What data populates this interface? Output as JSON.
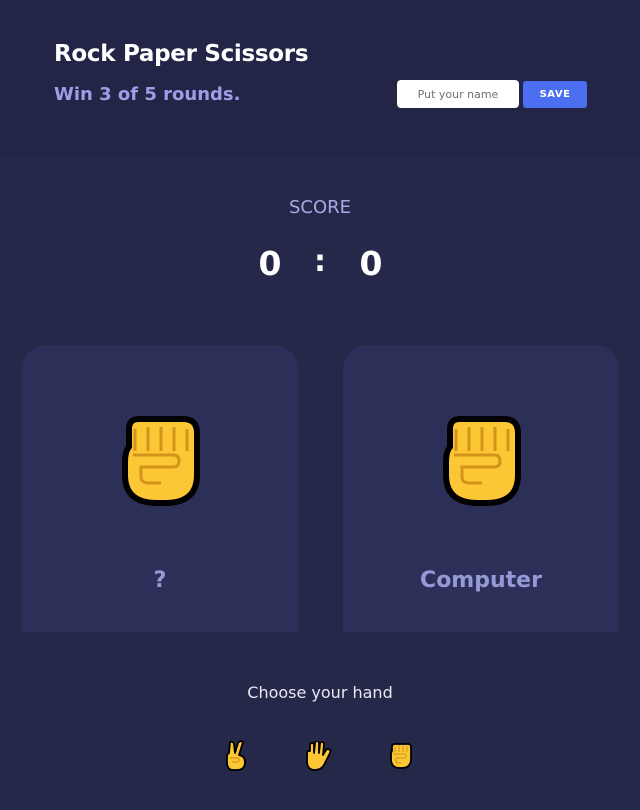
{
  "header": {
    "title": "Rock Paper Scissors",
    "subtitle": "Win 3 of 5 rounds.",
    "name_placeholder": "Put your name",
    "name_value": "",
    "save_label": "SAVE"
  },
  "score": {
    "label": "SCORE",
    "player": "0",
    "separator": ":",
    "computer": "0"
  },
  "cards": {
    "player": {
      "label": "?",
      "hand": "fist-icon"
    },
    "computer": {
      "label": "Computer",
      "hand": "fist-icon"
    }
  },
  "choices": {
    "label": "Choose your hand",
    "options": [
      "scissors-hand-icon",
      "paper-hand-icon",
      "rock-hand-icon"
    ]
  },
  "colors": {
    "background": "#252849",
    "header": "#222545",
    "card": "#2c3058",
    "accent": "#4c6ef0",
    "subtitle": "#9d9ee8",
    "hand_yellow": "#fcc734"
  }
}
